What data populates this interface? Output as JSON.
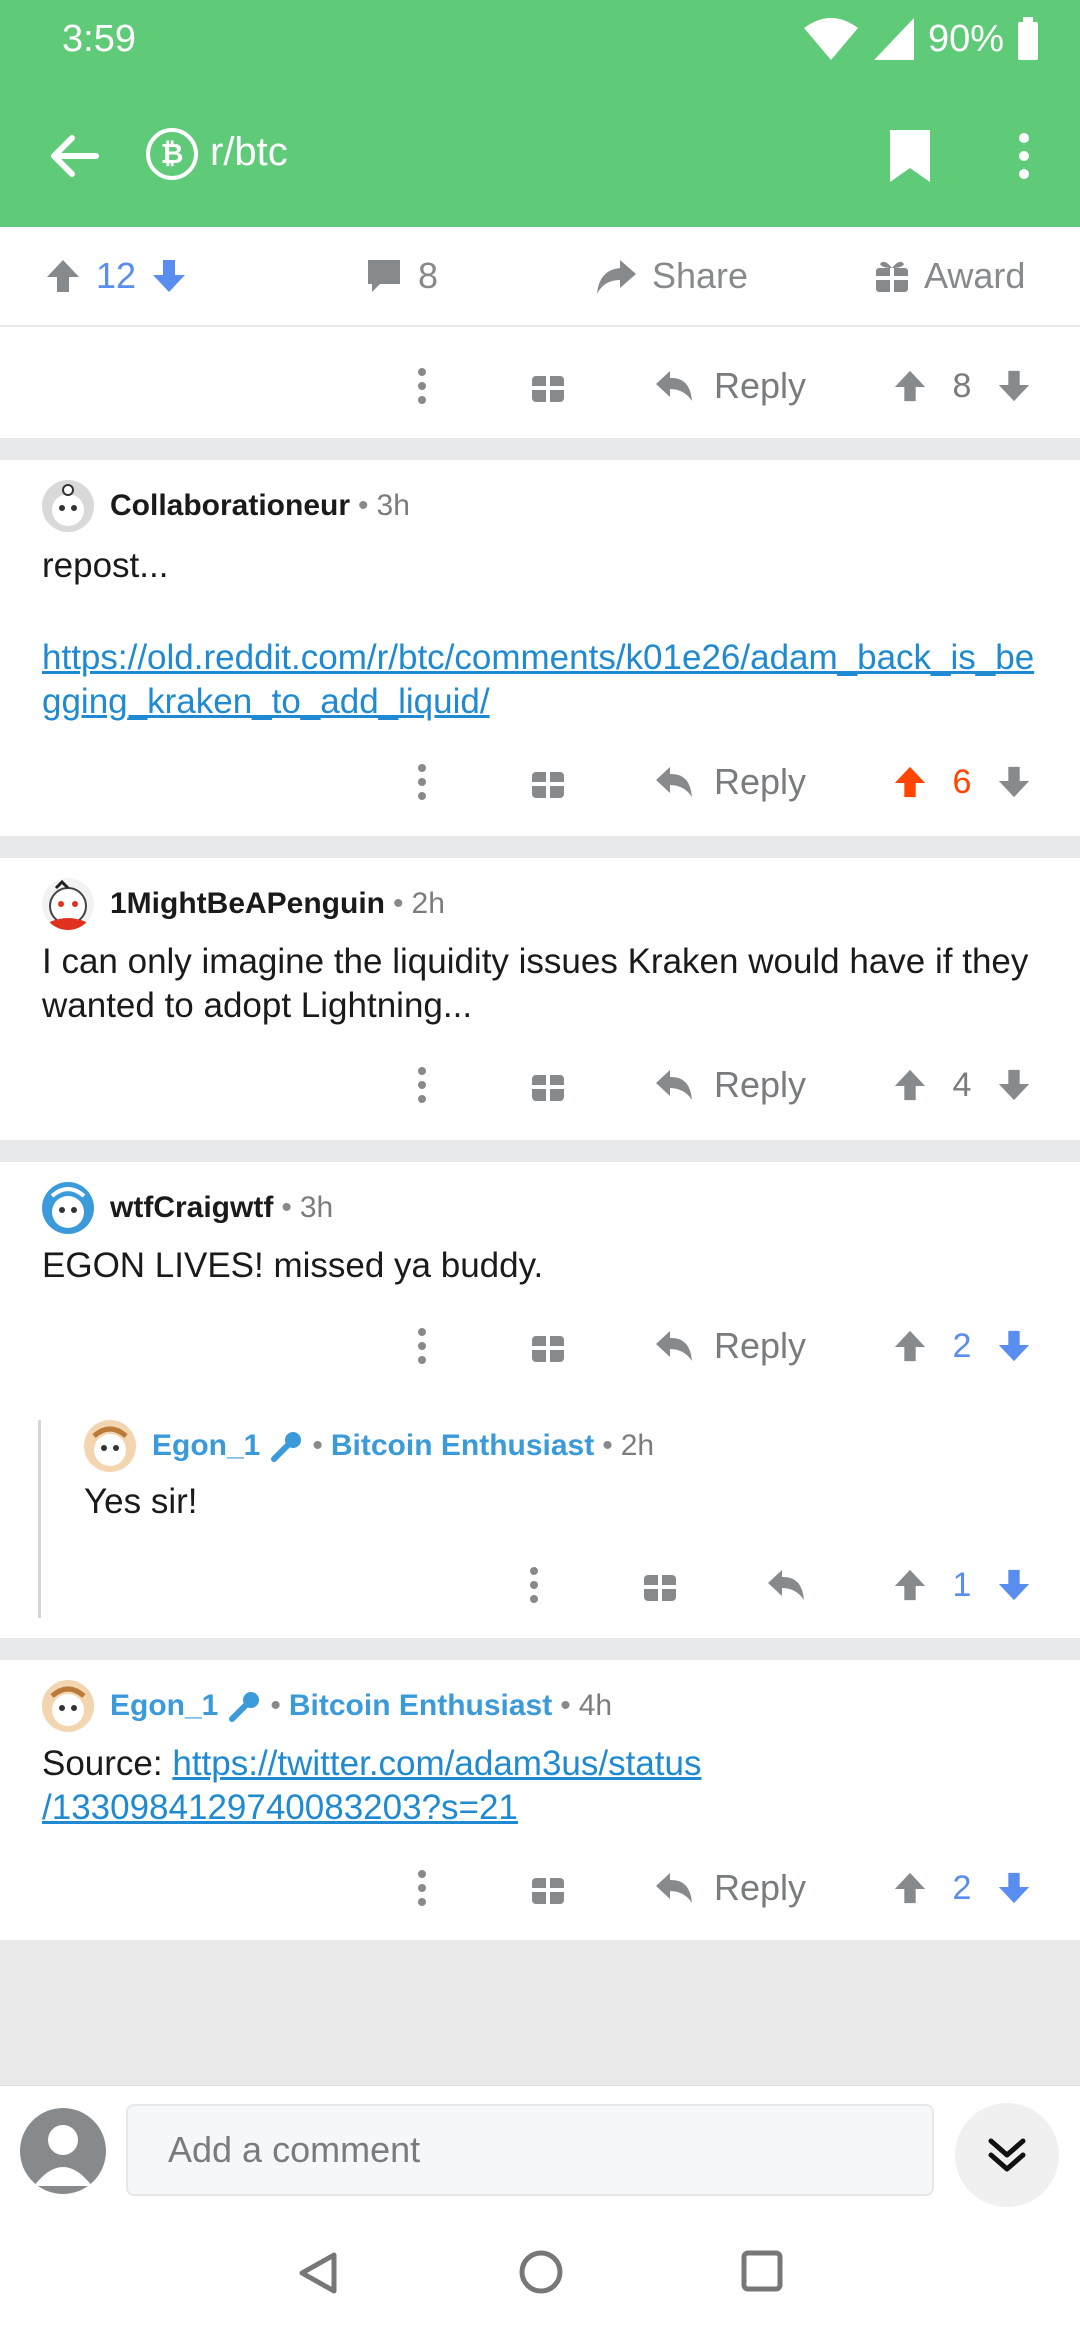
{
  "status": {
    "time": "3:59",
    "battery": "90%"
  },
  "toolbar": {
    "subreddit": "r/btc",
    "subreddit_icon_glyph": "₿"
  },
  "post_actions": {
    "score": "12",
    "comments": "8",
    "share": "Share",
    "award": "Award"
  },
  "colors": {
    "header": "#5fca78",
    "link": "#1f8ad1",
    "upvote_orange": "#ff4500",
    "downvote_blue": "#5a8df0",
    "flair": "#3b9ad9"
  },
  "top_actions": {
    "reply": "Reply",
    "score": "8"
  },
  "comments": [
    {
      "username": "Collaborationeur",
      "time": "3h",
      "text": "repost...",
      "link": "https://old.reddit.com/r/btc/comments/k01e26/adam_back_is_begging_kraken_to_add_liquid/",
      "reply": "Reply",
      "score": "6"
    },
    {
      "username": "1MightBeAPenguin",
      "time": "2h",
      "text": "I can only imagine the liquidity issues Kraken would have if they wanted to adopt Lightning...",
      "reply": "Reply",
      "score": "4"
    },
    {
      "username": "wtfCraigwtf",
      "time": "3h",
      "text": "EGON LIVES! missed ya buddy.",
      "reply": "Reply",
      "score": "2",
      "replies": [
        {
          "username": "Egon_1",
          "flair": "Bitcoin Enthusiast",
          "time": "2h",
          "text": "Yes sir!",
          "score": "1"
        }
      ]
    },
    {
      "username": "Egon_1",
      "flair": "Bitcoin Enthusiast",
      "time": "4h",
      "text_prefix": "Source: ",
      "link": "https://twitter.com/adam3us/status/1330984129740083203?s=21",
      "link_line1": "https://twitter.com/adam3us/status",
      "link_line2": "/1330984129740083203?s=21",
      "reply": "Reply",
      "score": "2"
    }
  ],
  "comment_input": {
    "placeholder": "Add a comment"
  }
}
